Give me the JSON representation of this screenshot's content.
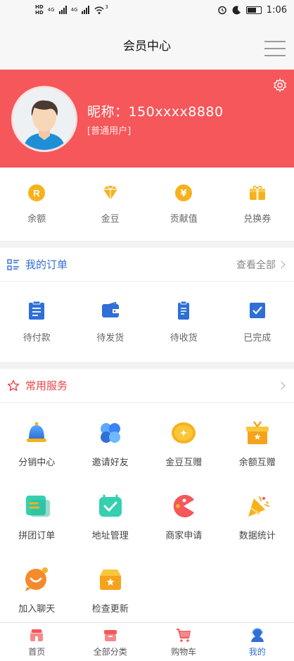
{
  "status_bar": {
    "hd1": "HD",
    "hd2": "HD",
    "net1": "4G",
    "net2": "4G",
    "wifi_label": "3",
    "time": "1:06"
  },
  "header": {
    "title": "会员中心"
  },
  "profile": {
    "nickname": "昵称：150xxxx8880",
    "user_type": "[普通用户]",
    "bg_color": "#f5575a"
  },
  "wallet": [
    {
      "label": "余额",
      "icon": "balance-icon"
    },
    {
      "label": "金豆",
      "icon": "gold-bean-icon"
    },
    {
      "label": "贡献值",
      "icon": "contribution-icon"
    },
    {
      "label": "兑换券",
      "icon": "coupon-icon"
    }
  ],
  "orders": {
    "title": "我的订单",
    "view_all": "查看全部",
    "items": [
      {
        "label": "待付款",
        "icon": "pending-payment-icon"
      },
      {
        "label": "待发货",
        "icon": "pending-shipment-icon"
      },
      {
        "label": "待收货",
        "icon": "pending-receipt-icon"
      },
      {
        "label": "已完成",
        "icon": "completed-icon"
      }
    ]
  },
  "services": {
    "title": "常用服务",
    "items": [
      {
        "label": "分销中心",
        "icon": "bell-icon"
      },
      {
        "label": "邀请好友",
        "icon": "invite-icon"
      },
      {
        "label": "金豆互赠",
        "icon": "coin-icon"
      },
      {
        "label": "余额互赠",
        "icon": "gift-box-icon"
      },
      {
        "label": "拼团订单",
        "icon": "group-order-icon"
      },
      {
        "label": "地址管理",
        "icon": "address-icon"
      },
      {
        "label": "商家申请",
        "icon": "merchant-icon"
      },
      {
        "label": "数据统计",
        "icon": "party-icon"
      },
      {
        "label": "加入聊天",
        "icon": "chat-icon"
      },
      {
        "label": "检查更新",
        "icon": "update-icon"
      }
    ]
  },
  "tabbar": [
    {
      "label": "首页",
      "icon": "home-icon"
    },
    {
      "label": "全部分类",
      "icon": "category-icon"
    },
    {
      "label": "购物车",
      "icon": "cart-icon"
    },
    {
      "label": "我的",
      "icon": "profile-icon",
      "active": true
    }
  ],
  "colors": {
    "accent": "#f5575a",
    "blue": "#2f6fd6",
    "gold": "#f6b21c"
  }
}
